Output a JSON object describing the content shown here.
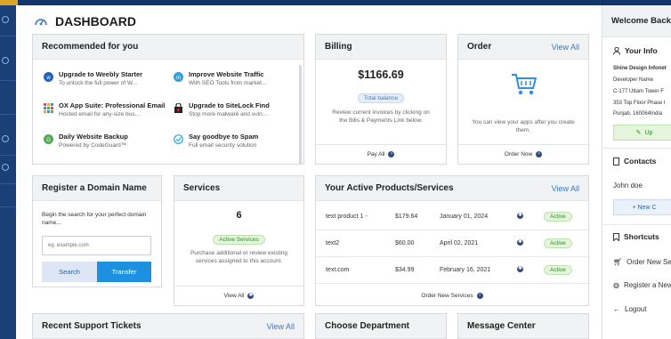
{
  "dashboard": {
    "title": "DASHBOARD"
  },
  "recommended": {
    "title": "Recommended for you",
    "items": [
      {
        "title": "Upgrade to Weebly Starter",
        "desc": "To unlock the full power of W...",
        "icon": "weebly-icon"
      },
      {
        "title": "Improve Website Traffic",
        "desc": "With SEO Tools from market...",
        "icon": "marketgoo-icon"
      },
      {
        "title": "OX App Suite: Professional Email",
        "desc": "Hosted email for any-size bus...",
        "icon": "ox-app-suite-icon"
      },
      {
        "title": "Upgrade to SiteLock Find",
        "desc": "Stop more malware and vuln...",
        "icon": "sitelock-icon"
      },
      {
        "title": "Daily Website Backup",
        "desc": "Powered by CodeGuard™",
        "icon": "codeguard-icon"
      },
      {
        "title": "Say goodbye to Spam",
        "desc": "Full email security solution",
        "icon": "spam-filter-icon"
      }
    ]
  },
  "billing": {
    "title": "Billing",
    "amount": "$1166.69",
    "badge": "Total balance",
    "desc": "Review current invoices by clicking on the Bills & Payments Link below.",
    "footer": "Pay All"
  },
  "order": {
    "title": "Order",
    "view_all": "View All",
    "desc": "You can view your apps after you create them.",
    "footer": "Order Now"
  },
  "domain": {
    "title": "Register a Domain Name",
    "prompt": "Begin the search for your perfect domain name...",
    "placeholder": "eg. example.com",
    "search": "Search",
    "transfer": "Transfer"
  },
  "services": {
    "title": "Services",
    "count": "6",
    "badge": "Active Services",
    "desc": "Purchase additional or review existing services assigned to this account.",
    "footer": "View All"
  },
  "products": {
    "title": "Your Active Products/Services",
    "view_all": "View All",
    "rows": [
      {
        "name": "text product 1 -",
        "price": "$179.64",
        "date": "January 01, 2024",
        "status": "Active"
      },
      {
        "name": "text2",
        "price": "$60.00",
        "date": "April 02, 2021",
        "status": "Active"
      },
      {
        "name": "text.com",
        "price": "$34.99",
        "date": "February 16, 2021",
        "status": "Active"
      }
    ],
    "footer": "Order New Services"
  },
  "support": {
    "title": "Recent Support Tickets",
    "view_all": "View All"
  },
  "department": {
    "title": "Choose Department"
  },
  "messages": {
    "title": "Message Center"
  },
  "right_panel": {
    "welcome": "Welcome Back",
    "your_info": "Your Info",
    "company": "Shine Design Infonet",
    "address_lines": [
      "Developer Name",
      "C-177 Uttam Tower F",
      "353 Top Floor Phase I",
      "Punjab, 160064India"
    ],
    "update_label": "Up",
    "contacts": "Contacts",
    "contact_name": "John doe",
    "new_contact": "+ New C",
    "shortcuts": "Shortcuts",
    "shortcut_items": [
      "Order New Se",
      "Register a New",
      "Logout"
    ]
  },
  "colors": {
    "accent": "#3b78c4",
    "nav": "#1c3f78",
    "active": "#2f8a2f",
    "button": "#1e90e0"
  }
}
